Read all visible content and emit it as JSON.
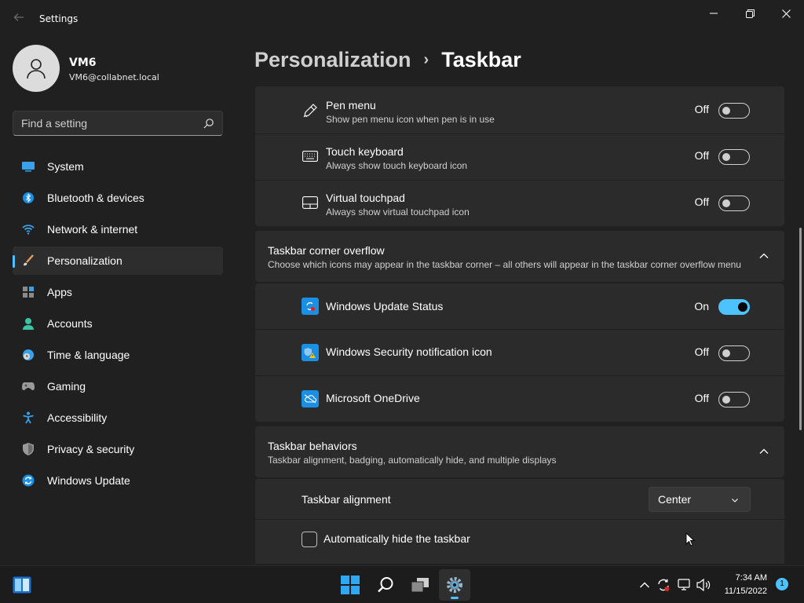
{
  "window": {
    "title": "Settings",
    "back_icon": "back-arrow-icon",
    "controls": [
      "minimize-icon",
      "restore-icon",
      "close-icon"
    ]
  },
  "profile": {
    "name": "VM6",
    "email": "VM6@collabnet.local"
  },
  "search": {
    "placeholder": "Find a setting",
    "value": ""
  },
  "sidebar": {
    "accent_color": "#4cc2ff",
    "items": [
      {
        "label": "System",
        "icon": "system-icon",
        "active": false
      },
      {
        "label": "Bluetooth & devices",
        "icon": "bluetooth-icon",
        "active": false
      },
      {
        "label": "Network & internet",
        "icon": "wifi-icon",
        "active": false
      },
      {
        "label": "Personalization",
        "icon": "brush-icon",
        "active": true
      },
      {
        "label": "Apps",
        "icon": "apps-icon",
        "active": false
      },
      {
        "label": "Accounts",
        "icon": "accounts-icon",
        "active": false
      },
      {
        "label": "Time & language",
        "icon": "globe-clock-icon",
        "active": false
      },
      {
        "label": "Gaming",
        "icon": "gamepad-icon",
        "active": false
      },
      {
        "label": "Accessibility",
        "icon": "accessibility-icon",
        "active": false
      },
      {
        "label": "Privacy & security",
        "icon": "shield-icon",
        "active": false
      },
      {
        "label": "Windows Update",
        "icon": "update-icon",
        "active": false
      }
    ]
  },
  "breadcrumb": {
    "parent": "Personalization",
    "separator": "›",
    "current": "Taskbar"
  },
  "corner_icons": {
    "items": [
      {
        "title": "Pen menu",
        "subtitle": "Show pen menu icon when pen is in use",
        "state": "Off",
        "on": false,
        "icon": "pen-icon"
      },
      {
        "title": "Touch keyboard",
        "subtitle": "Always show touch keyboard icon",
        "state": "Off",
        "on": false,
        "icon": "keyboard-icon"
      },
      {
        "title": "Virtual touchpad",
        "subtitle": "Always show virtual touchpad icon",
        "state": "Off",
        "on": false,
        "icon": "touchpad-icon"
      }
    ]
  },
  "overflow": {
    "title": "Taskbar corner overflow",
    "subtitle": "Choose which icons may appear in the taskbar corner – all others will appear in the taskbar corner overflow menu",
    "items": [
      {
        "title": "Windows Update Status",
        "state": "On",
        "on": true,
        "icon": "windows-update-status-icon"
      },
      {
        "title": "Windows Security notification icon",
        "state": "Off",
        "on": false,
        "icon": "windows-security-icon"
      },
      {
        "title": "Microsoft OneDrive",
        "state": "Off",
        "on": false,
        "icon": "onedrive-icon"
      }
    ]
  },
  "behaviors": {
    "title": "Taskbar behaviors",
    "subtitle": "Taskbar alignment, badging, automatically hide, and multiple displays",
    "alignment_label": "Taskbar alignment",
    "alignment_value": "Center",
    "autohide_label": "Automatically hide the taskbar",
    "autohide_checked": false
  },
  "taskbar": {
    "apps": [
      "windows-widgets-icon",
      "start-icon",
      "search-icon",
      "task-view-icon",
      "settings-icon"
    ],
    "tray": [
      "chevron-up-icon",
      "update-status-icon",
      "network-icon",
      "volume-icon"
    ],
    "time": "7:34 AM",
    "date": "11/15/2022",
    "notification_count": "1"
  }
}
